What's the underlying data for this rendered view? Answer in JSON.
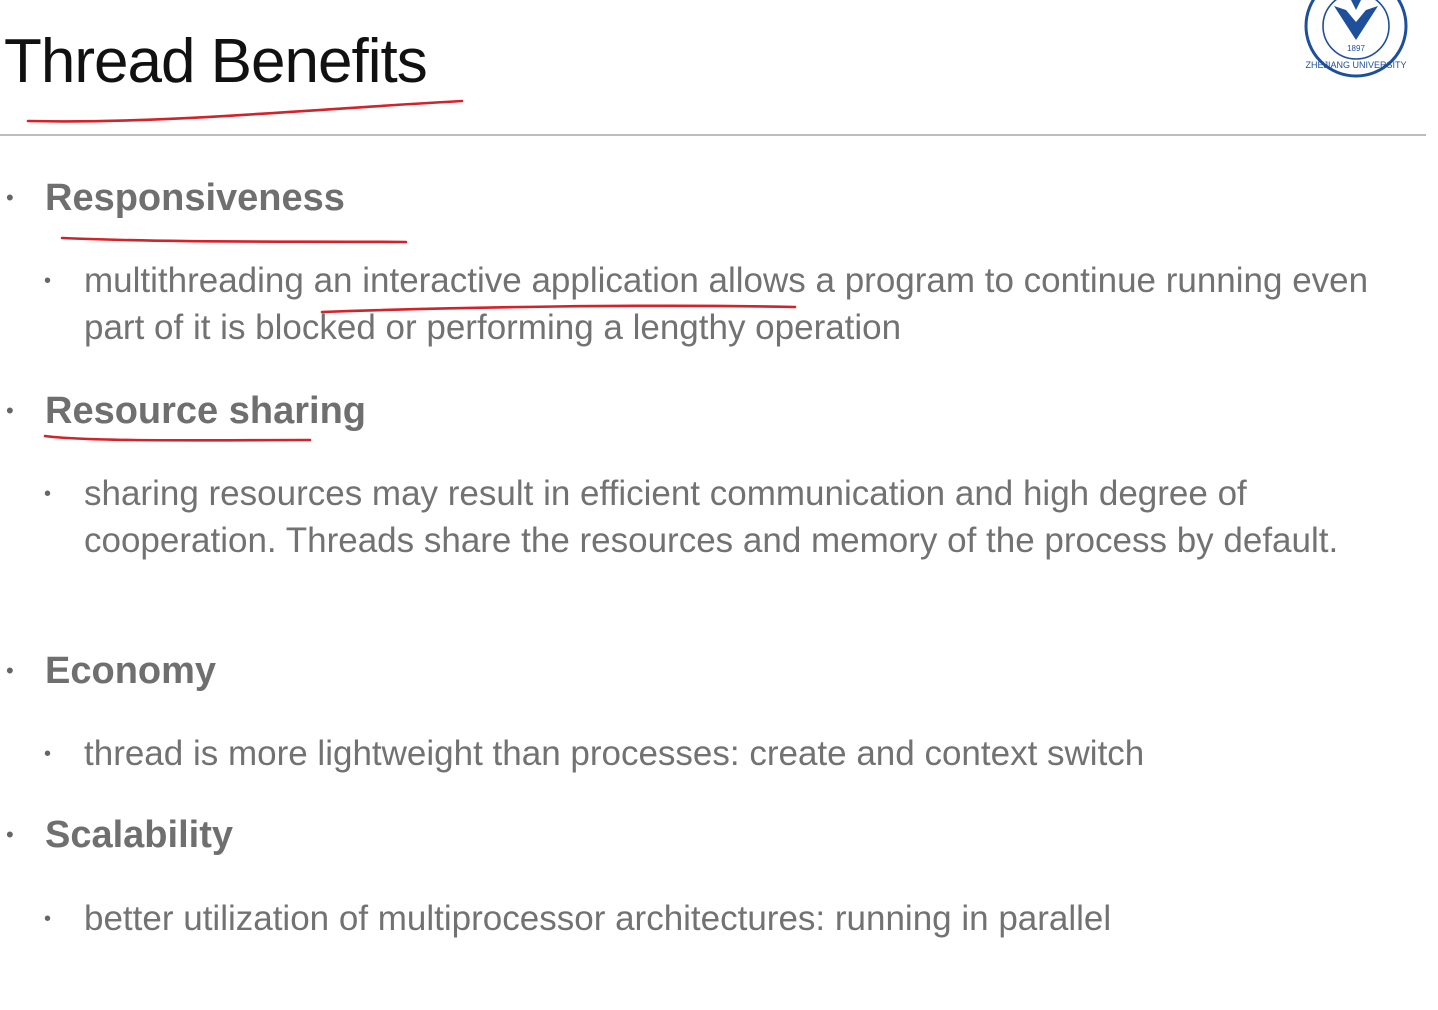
{
  "slide": {
    "title": "Thread Benefits",
    "logo": {
      "icon": "zhejiang-university-seal-icon",
      "year": "1897",
      "name": "ZHEJIANG UNIVERSITY",
      "color": "#1e4f9a"
    },
    "annotation_color": "#d3222a",
    "items": [
      {
        "heading": "Responsiveness",
        "body": "multithreading an interactive application allows a program to continue running even part of it is blocked or performing a lengthy operation"
      },
      {
        "heading": "Resource sharing",
        "body": "sharing resources may result in efficient communication and high degree of cooperation. Threads share the resources and memory of the process by default."
      },
      {
        "heading": "Economy",
        "body": "thread is more lightweight than processes: create and context switch"
      },
      {
        "heading": "Scalability",
        "body": "better utilization of multiprocessor architectures: running in parallel"
      }
    ]
  }
}
